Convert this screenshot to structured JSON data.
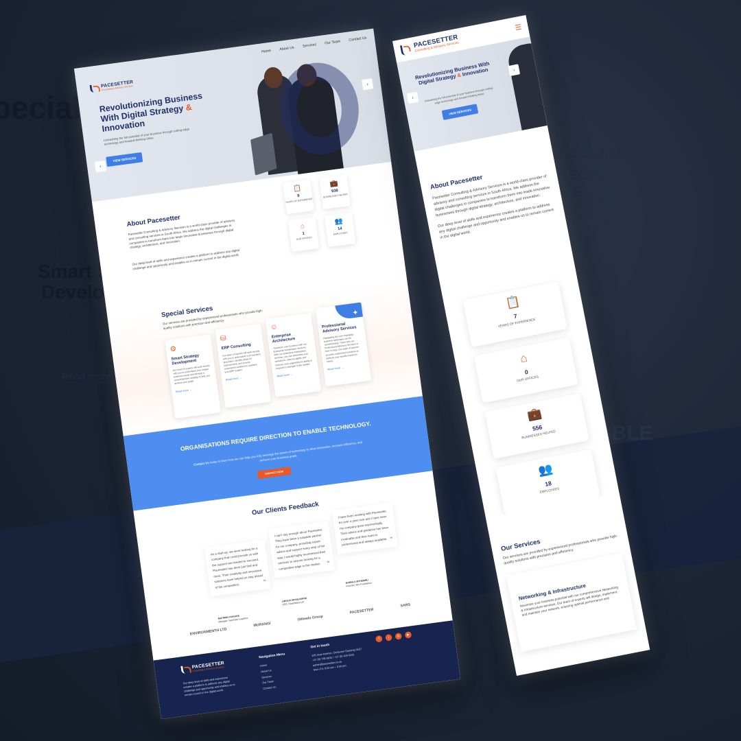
{
  "brand": {
    "name": "PACESETTER",
    "tagline": "Consulting & Advisory Services",
    "accent": "#e85a2a",
    "primary": "#1f2f6b",
    "blue": "#3f7ee5"
  },
  "nav": {
    "items": [
      "Home",
      "About Us",
      "Services",
      "Our Team",
      "Contact Us"
    ]
  },
  "hero": {
    "title_main": "Revolutionizing Business With Digital Strategy",
    "title_amp": "&",
    "title_end": "Innovation",
    "subtitle": "Unleashing the full potential of your business through cutting-edge technology and forward-thinking ideas.",
    "cta": "VIEW SERVICES",
    "prev_icon": "‹",
    "next_icon": "›"
  },
  "about": {
    "title": "About Pacesetter",
    "p1": "Pacesetter Consulting & Advisory Services is a world-class provider of advisory and consulting services in South Africa. We address the digital challenges in companies to transform them into leads innovative businesses through digital strategy, architecture, and innovation.",
    "p2": "Our deep level of skills and experience creates a platform to address any digital challenge and opportunity and enables us to remain current in the digital world.",
    "stats": [
      {
        "num": "9",
        "label": "YEARS OF EXPERIENCE",
        "icon": "clipboard-icon"
      },
      {
        "num": "938",
        "label": "BUSINESSES HELPED",
        "icon": "briefcase-icon"
      },
      {
        "num": "1",
        "label": "OUR OFFICES",
        "icon": "house-icon"
      },
      {
        "num": "14",
        "label": "EMPLOYEES",
        "icon": "team-icon"
      }
    ]
  },
  "services": {
    "title": "Special Services",
    "subtitle": "Our services are provided by experienced professionals who provide high-quality solutions with precision and efficiency.",
    "cards": [
      {
        "title": "Smart Strategy Development",
        "desc": "Our team of experts will work closely with you to understand your unique business needs and develop a comprehensive strategy to help you achieve your goals.",
        "link": "Read more →"
      },
      {
        "title": "ERP Consulting",
        "desc": "Our team of experts will work closely with you to understand your business processes, identify areas for improvement, and provide customized solutions to optimize your ERP system.",
        "link": "Read more →"
      },
      {
        "title": "Enterprise Architecture",
        "desc": "Transform your business with our Enterprise Architecture services. With our Enterprise Architecture services, you can streamline your operations, improve agility, and improve your organization's ability to respond to changes in the market.",
        "link": "Read more →"
      },
      {
        "title": "Professional Advisory Services",
        "desc": "Navigating the ever-changing business landscape can be overwhelming. That's why our Professional Advisory Services is here to help. Our team of experts provides customized solutions to address your specific business needs.",
        "link": "Read more →"
      }
    ]
  },
  "banner": {
    "title": "ORGANISATIONS REQUIRE DIRECTION TO ENABLE TECHNOLOGY.",
    "sub_lead": "Contact Us",
    "sub": "today to learn how we can help you fully leverage the power of technology to drive innovation, increase efficiency, and achieve your business goals.",
    "cta": "CONTACT NOW"
  },
  "feedback": {
    "title": "Our Clients Feedback",
    "items": [
      {
        "text": "As a start-up, we were looking for a company that could provide us with the support we needed to succeed. Pacesetter has done just that and more. Their creativity and innovative solutions have helped us stay ahead of the competition.",
        "name": "MATIMBA KHAUKE",
        "role": "Manager, Sammaur Logistics"
      },
      {
        "text": "I can't say enough about Pacesetter. They have been a valuable partner for our company, providing expert advice and support every step of the way. I would highly recommend their services to anyone looking for a competitive edge in the market.",
        "name": "LIBOLIA MASILAMANI",
        "role": "CEO, SmartWays Ltd"
      },
      {
        "text": "I have been working with Pacesetter for over a year now and I have seen my company grow exponentially. Their advice and guidance has been invaluable and their team is professional and always available.",
        "name": "NAMHLA MTHEMBU",
        "role": "Founder, Wei Foundation"
      }
    ],
    "quote_icon": "”",
    "logos": [
      "ENVIRONMENTH LTD",
      "MURANGI",
      "Olilwelu Group",
      "PACESETTER",
      "SARS"
    ]
  },
  "footer": {
    "about": "Our deep level of skills and experience creates a platform to address any digital challenge and opportunity and enables us to remain current in the digital world.",
    "nav_title": "Navigation Menu",
    "nav_items": [
      "Home",
      "About Us",
      "Services",
      "Our Team",
      "Contact Us"
    ],
    "contact_title": "Get in touch",
    "address": "105 Jean Avenue, Centurion Gauteng 0157",
    "phone1": "+27 (0) 765 6632 / +27 (0) 429 9242",
    "email": "admin@pacesetter.co.za",
    "hours": "Mon–Fri: 8:00 am – 5:00 pm",
    "social": [
      "f",
      "t",
      "◎",
      "▶"
    ]
  },
  "mobile": {
    "menu_icon": "☰",
    "stats": [
      {
        "num": "7",
        "label": "YEARS OF EXPERIENCE"
      },
      {
        "num": "0",
        "label": "OUR OFFICES"
      },
      {
        "num": "556",
        "label": "BUSINESSES HELPED"
      },
      {
        "num": "18",
        "label": "EMPLOYEES"
      }
    ],
    "services_title": "Our Services",
    "card_title": "Networking & Infrastructure",
    "card_desc": "Maximize your business potential with our comprehensive Networking & Infrastructure services. Our team of experts will design, implement, and maintain your network, ensuring optimal performance and"
  },
  "bg": {
    "w1": "pecial S",
    "w2": "Smart Stra",
    "w3": "Developme",
    "w4": "ofessional",
    "w5": "dvisory",
    "w6": "rvices",
    "w7": "ABLE",
    "read": "Read more →"
  }
}
